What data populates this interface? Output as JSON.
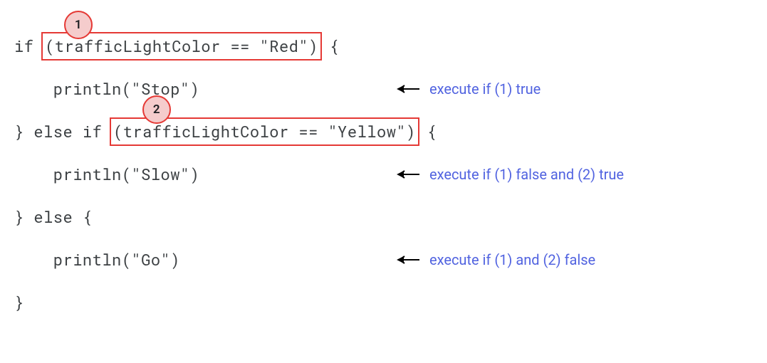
{
  "code": {
    "line1_pre": "if ",
    "line1_boxed": "(trafficLightColor == \"Red\")",
    "line1_post": " {",
    "line2": "    println(\"Stop\")",
    "line3_pre": "} else if ",
    "line3_boxed": "(trafficLightColor == \"Yellow\")",
    "line3_post": " {",
    "line4": "    println(\"Slow\")",
    "line5": "} else {",
    "line6": "    println(\"Go\")",
    "line7": "}"
  },
  "badges": {
    "b1": "1",
    "b2": "2"
  },
  "annotations": {
    "a1": "execute if (1) true",
    "a2": "execute if (1) false and (2) true",
    "a3": "execute if (1) and (2) false"
  }
}
